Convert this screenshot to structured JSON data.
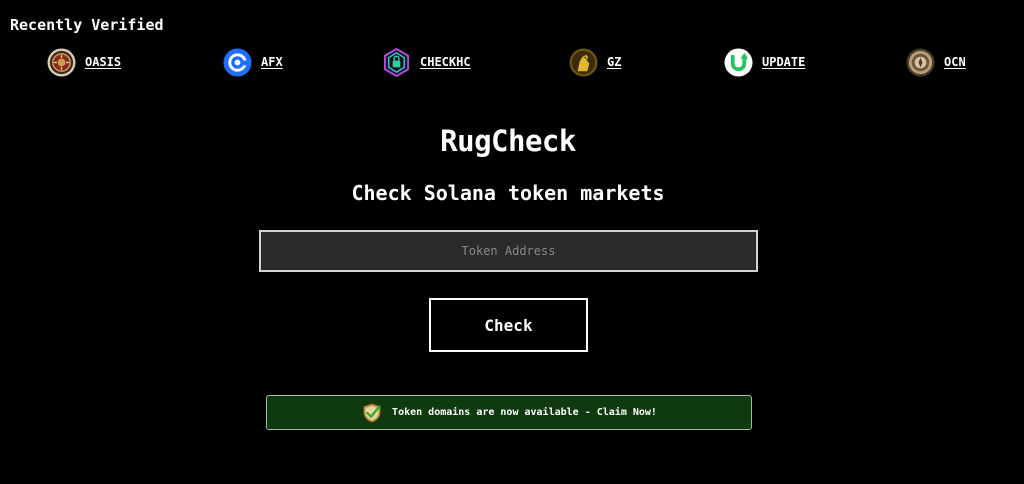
{
  "recently_verified": {
    "title": "Recently Verified",
    "tokens": [
      {
        "symbol": "OASIS",
        "icon": "oasis-token-logo-icon"
      },
      {
        "symbol": "AFX",
        "icon": "afx-token-logo-icon"
      },
      {
        "symbol": "CHECKHC",
        "icon": "checkhc-token-logo-icon"
      },
      {
        "symbol": "GZ",
        "icon": "gz-token-logo-icon"
      },
      {
        "symbol": "UPDATE",
        "icon": "update-token-logo-icon"
      },
      {
        "symbol": "OCN",
        "icon": "ocn-token-logo-icon"
      }
    ]
  },
  "hero": {
    "brand": "RugCheck",
    "subtitle": "Check Solana token markets"
  },
  "search": {
    "value": "",
    "placeholder": "Token Address"
  },
  "check_button": {
    "label": "Check"
  },
  "banner": {
    "text": "Token domains are now available - Claim Now!",
    "icon": "shield-check-icon"
  },
  "colors": {
    "background": "#000000",
    "text": "#ffffff",
    "input_background": "#2a2a2a",
    "banner_background": "#0f3a10",
    "afx_blue": "#1f6fff",
    "update_green": "#22c55e"
  }
}
